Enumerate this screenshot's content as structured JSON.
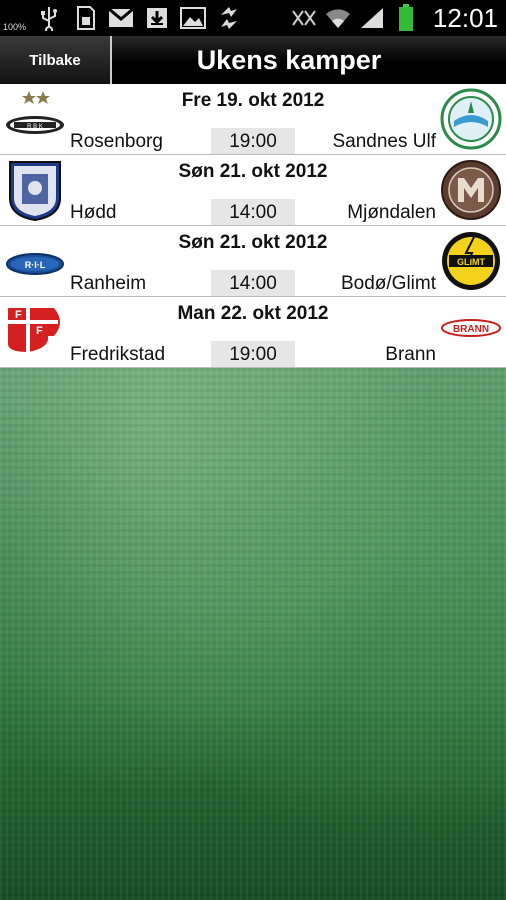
{
  "status_bar": {
    "battery_percent": "100%",
    "time": "12:01",
    "left_icons": [
      "usb-icon",
      "sd-card-icon",
      "gmail-icon",
      "download-icon",
      "gallery-icon",
      "sync-icon"
    ],
    "right_icons": [
      "mute-icon",
      "wifi-icon",
      "signal-icon",
      "battery-icon"
    ]
  },
  "header": {
    "back_label": "Tilbake",
    "title": "Ukens kamper"
  },
  "matches": [
    {
      "date": "Fre 19. okt 2012",
      "home": "Rosenborg",
      "time": "19:00",
      "away": "Sandnes Ulf",
      "home_logo": "rosenborg-logo",
      "away_logo": "sandnes-ulf-logo"
    },
    {
      "date": "Søn 21. okt 2012",
      "home": "Hødd",
      "time": "14:00",
      "away": "Mjøndalen",
      "home_logo": "hodd-logo",
      "away_logo": "mjondalen-logo"
    },
    {
      "date": "Søn 21. okt 2012",
      "home": "Ranheim",
      "time": "14:00",
      "away": "Bodø/Glimt",
      "home_logo": "ranheim-logo",
      "away_logo": "bodo-glimt-logo",
      "home_logo_text": "R·I·L",
      "away_logo_text": "GLIMT"
    },
    {
      "date": "Man 22. okt 2012",
      "home": "Fredrikstad",
      "time": "19:00",
      "away": "Brann",
      "home_logo": "fredrikstad-logo",
      "away_logo": "brann-logo",
      "away_logo_text": "BRANN"
    }
  ],
  "colors": {
    "header_bg": "#000000",
    "row_bg": "#ffffff",
    "time_bg": "#e6e6e6",
    "grass": "#2f7740"
  }
}
